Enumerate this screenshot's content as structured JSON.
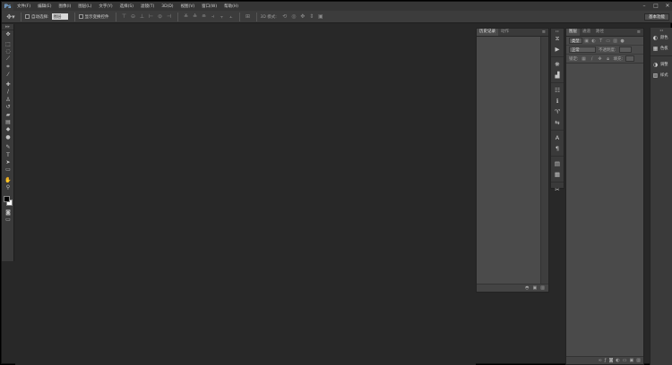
{
  "app": {
    "logo": "Ps"
  },
  "menu": [
    "文件(F)",
    "编辑(E)",
    "图像(I)",
    "图层(L)",
    "文字(Y)",
    "选择(S)",
    "滤镜(T)",
    "3D(D)",
    "视图(V)",
    "窗口(W)",
    "帮助(H)"
  ],
  "window_controls": {
    "minimize": "–",
    "maximize": "□",
    "close": "✕"
  },
  "options_bar": {
    "tool_icon": "move-tool-icon",
    "auto_select_label": "自动选择:",
    "auto_select_value": "图层",
    "show_transform_label": "显示变换控件",
    "mode3d_label": "3D 模式:",
    "workspace": "基本功能"
  },
  "toolbar": {
    "tools": [
      {
        "name": "move-tool",
        "glyph": "✥"
      },
      {
        "name": "marquee-tool",
        "glyph": "⬚"
      },
      {
        "name": "lasso-tool",
        "glyph": "◌"
      },
      {
        "name": "quick-select-tool",
        "glyph": "⟋"
      },
      {
        "name": "crop-tool",
        "glyph": "⌗"
      },
      {
        "name": "eyedropper-tool",
        "glyph": "⁄"
      },
      {
        "name": "healing-brush-tool",
        "glyph": "✚"
      },
      {
        "name": "brush-tool",
        "glyph": "∕"
      },
      {
        "name": "clone-stamp-tool",
        "glyph": "♙"
      },
      {
        "name": "history-brush-tool",
        "glyph": "↺"
      },
      {
        "name": "eraser-tool",
        "glyph": "▰"
      },
      {
        "name": "gradient-tool",
        "glyph": "▤"
      },
      {
        "name": "blur-tool",
        "glyph": "◆"
      },
      {
        "name": "dodge-tool",
        "glyph": "●"
      },
      {
        "name": "pen-tool",
        "glyph": "✎"
      },
      {
        "name": "type-tool",
        "glyph": "T"
      },
      {
        "name": "path-select-tool",
        "glyph": "➤"
      },
      {
        "name": "shape-tool",
        "glyph": "▭"
      },
      {
        "name": "hand-tool",
        "glyph": "✋"
      },
      {
        "name": "zoom-tool",
        "glyph": "⚲"
      }
    ]
  },
  "history_panel": {
    "tabs": [
      "历史记录",
      "动作"
    ],
    "menu_glyph": "≡"
  },
  "layers_panel": {
    "tabs": [
      "图层",
      "通道",
      "路径"
    ],
    "kind_label": "类型",
    "blend_mode": "正常",
    "opacity_label": "不透明度:",
    "lock_label": "锁定:",
    "fill_label": "填充:"
  },
  "right_panels": [
    {
      "icon": "colour-icon",
      "glyph": "◐",
      "label": "颜色"
    },
    {
      "icon": "swatches-icon",
      "glyph": "▦",
      "label": "色板"
    },
    {
      "icon": "adjustments-icon",
      "glyph": "◑",
      "label": "调整"
    },
    {
      "icon": "styles-icon",
      "glyph": "▨",
      "label": "样式"
    }
  ],
  "colors": {
    "canvas": "#282828",
    "panel": "#4a4a4a",
    "toolbar": "#3a3a3a",
    "foreground": "#000000",
    "background": "#ffffff"
  }
}
